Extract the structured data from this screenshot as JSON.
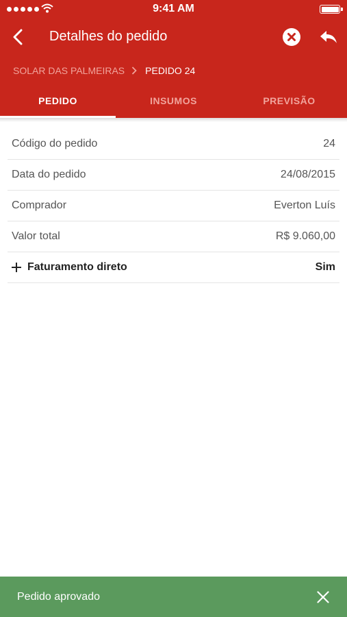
{
  "status_bar": {
    "time": "9:41 AM"
  },
  "nav": {
    "title": "Detalhes do pedido"
  },
  "breadcrumb": {
    "parent": "SOLAR DAS PALMEIRAS",
    "current": "PEDIDO 24"
  },
  "tabs": [
    {
      "label": "PEDIDO",
      "active": true
    },
    {
      "label": "INSUMOS",
      "active": false
    },
    {
      "label": "PREVISÃO",
      "active": false
    }
  ],
  "details": [
    {
      "label": "Código do pedido",
      "value": "24"
    },
    {
      "label": "Data do pedido",
      "value": "24/08/2015"
    },
    {
      "label": "Comprador",
      "value": "Everton Luís"
    },
    {
      "label": "Valor total",
      "value": "R$ 9.060,00"
    },
    {
      "label": "Faturamento direto",
      "value": "Sim"
    }
  ],
  "toast": {
    "message": "Pedido aprovado"
  },
  "colors": {
    "header": "#c8261c",
    "toast": "#5b9a5d",
    "tab_inactive": "#f1a49c"
  },
  "icons": [
    "back-chevron-icon",
    "cancel-circle-icon",
    "reply-arrow-icon",
    "chevron-right-icon",
    "plus-icon",
    "close-icon"
  ]
}
